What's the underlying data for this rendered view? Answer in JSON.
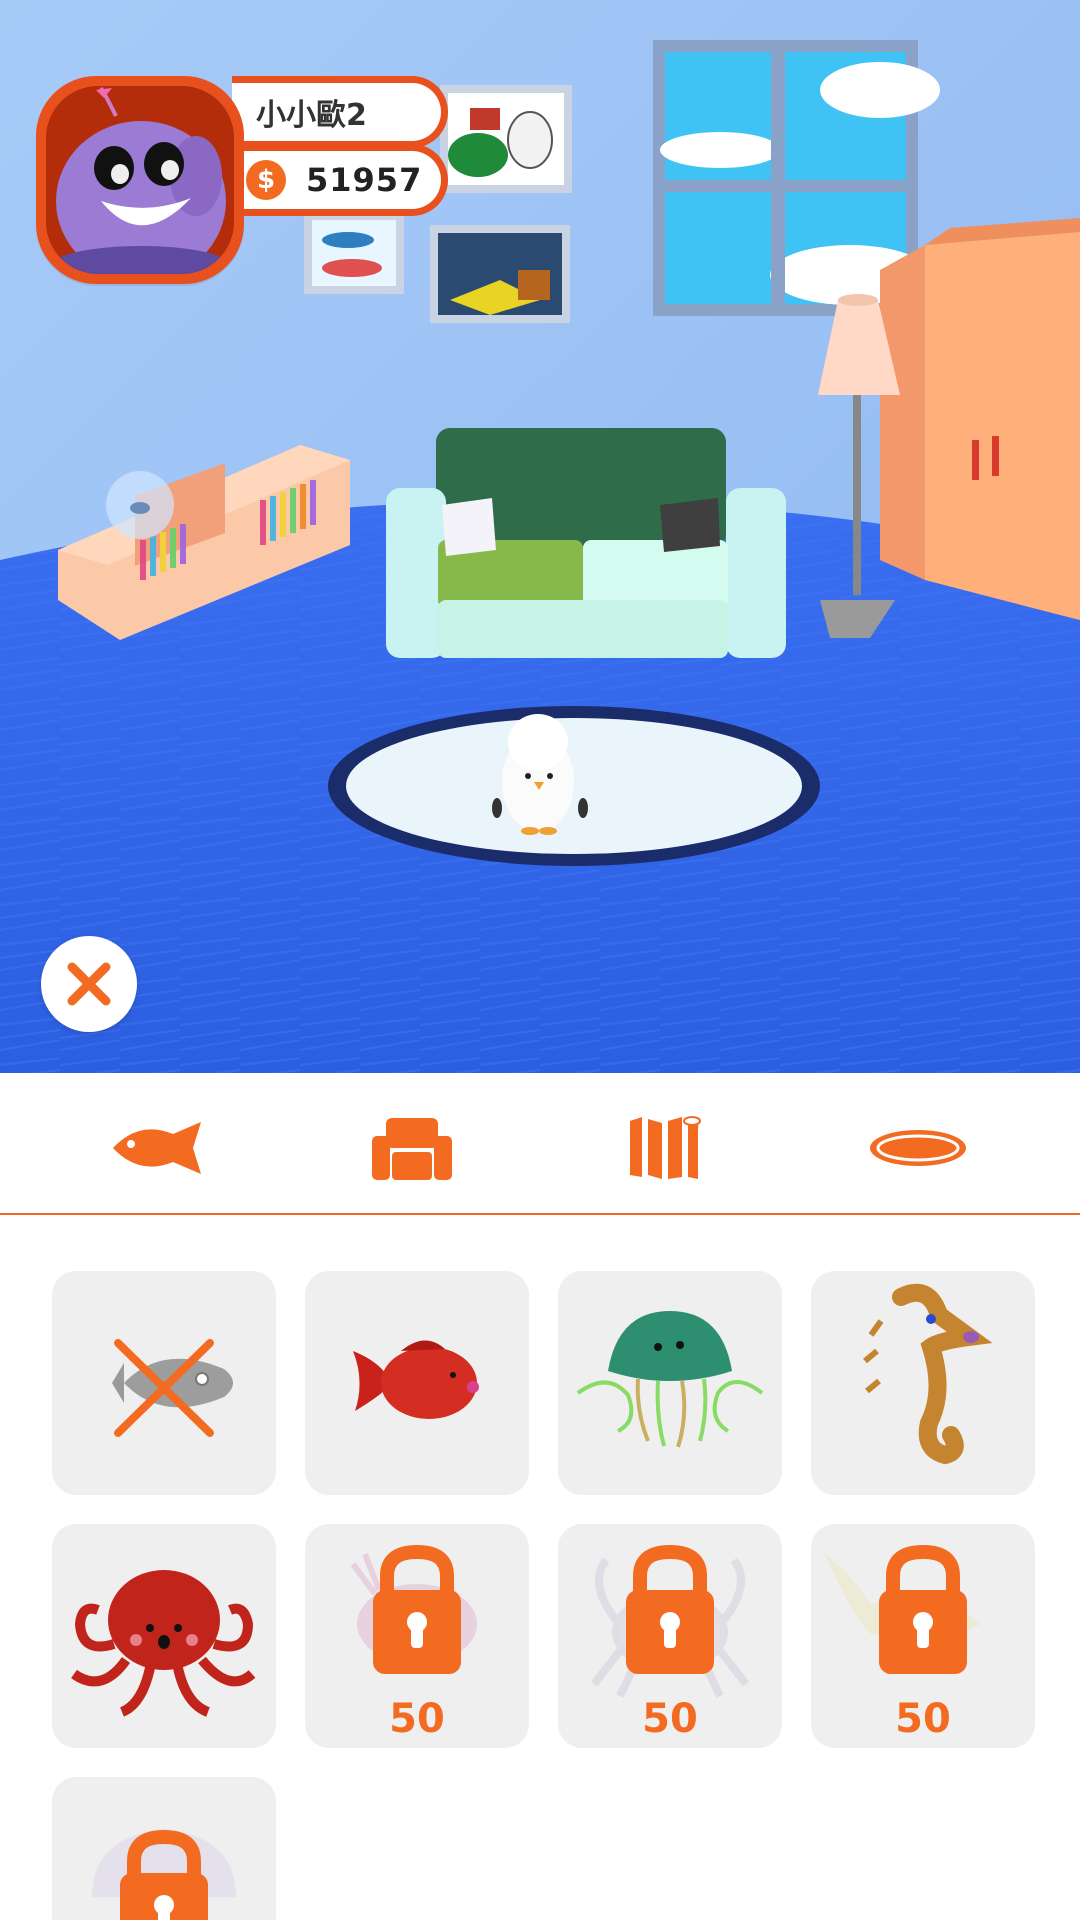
{
  "player": {
    "name": "小小歐2",
    "coin_symbol": "$",
    "coins": "51957"
  },
  "icons": {
    "close": "close-icon",
    "tabs": [
      "fish-icon",
      "sofa-icon",
      "wallpaper-icon",
      "rug-icon"
    ]
  },
  "colors": {
    "accent": "#f26b21",
    "wall": "#a9cffb",
    "floor": "#2f66e8",
    "cell_bg": "#efefef"
  },
  "items": [
    {
      "name": "none",
      "locked": false
    },
    {
      "name": "red-fish",
      "locked": false
    },
    {
      "name": "jellyfish",
      "locked": false
    },
    {
      "name": "seahorse",
      "locked": false
    },
    {
      "name": "octopus",
      "locked": false
    },
    {
      "name": "pink-fish",
      "locked": true,
      "price": "50"
    },
    {
      "name": "crab",
      "locked": true,
      "price": "50"
    },
    {
      "name": "yellow-fish",
      "locked": true,
      "price": "50"
    },
    {
      "name": "clam",
      "locked": true,
      "price": ""
    }
  ]
}
